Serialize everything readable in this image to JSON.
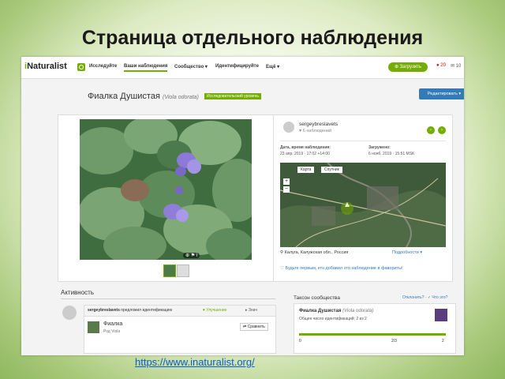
{
  "slide": {
    "title": "Страница отдельного наблюдения",
    "url": "https://www.inaturalist.org/"
  },
  "nav": {
    "logo_prefix": "i",
    "logo_rest": "Naturalist",
    "items": [
      "Исследуйте",
      "Ваши наблюдения",
      "Сообщество ▾",
      "Идентифицируйте",
      "Ещё ▾"
    ],
    "upload": "⊕ Загрузить",
    "notifications": "● 20",
    "messages": "✉ 10"
  },
  "observation": {
    "common_name": "Фиалка Душистая",
    "scientific_name": "(Viola odorata)",
    "grade": "Исследовательский уровень",
    "edit_button": "Редактировать ▾",
    "photo_controls": "⊕ ⚑ i"
  },
  "observer": {
    "username": "sergeybreslavets",
    "count": "♥ 6 наблюдений",
    "prev": "‹",
    "next": "›"
  },
  "details": {
    "observed_label": "Дата, время наблюдения:",
    "observed_value": "23 апр. 2019 · 17:02 +14:00",
    "uploaded_label": "Загружено:",
    "uploaded_value": "6 нояб. 2019 · 15:51 MSK"
  },
  "map": {
    "tab_map": "Карта",
    "tab_satellite": "Спутник",
    "zoom_in": "+",
    "zoom_out": "−",
    "place": "⚲ Калуга, Калужская обл., Россия",
    "more": "Подробности ▾",
    "favorite": "♡ Будьте первым, кто добавил это наблюдение в фавориты!"
  },
  "activity": {
    "heading": "Активность",
    "user": "sergeybreslavets",
    "action": "предложил идентификацию",
    "improve": "♥ Улучшение",
    "know": "▸ Знач",
    "taxon": "Фиалка",
    "rank": "Род Viola",
    "compare": "⇄ Сравнить"
  },
  "community": {
    "heading": "Таксон сообщества",
    "links": "Отклонить? · ✓ Что это?",
    "name": "Фиалка Душистая",
    "sci": "(Viola odorata)",
    "summary": "Общее число идентификаций: 2 из 2",
    "min": "0",
    "mid": "2/3",
    "max": "2"
  }
}
